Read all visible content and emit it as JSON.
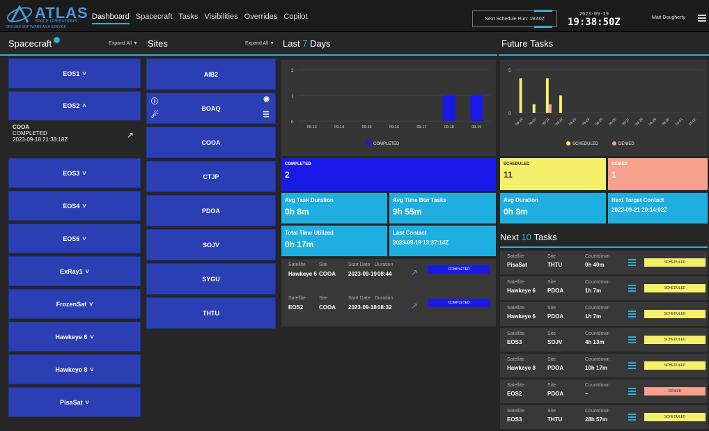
{
  "app": {
    "logo_title": "ATLAS",
    "logo_sub": "SPACE OPERATIONS",
    "logo_tag": "GROUND SOFTWARE AS A SERVICE",
    "nav": [
      "Dashboard",
      "Spacecraft",
      "Tasks",
      "Visibilities",
      "Overrides",
      "Copilot"
    ],
    "next_schedule": "Next Schedule Run: 19:40Z",
    "date": "2023-09-19",
    "time": "19:38:50Z",
    "user": "Matt Dougherty"
  },
  "spacecraft": {
    "title": "Spacecraft",
    "expand_label": "Expand All",
    "items": [
      "EOS1",
      "EOS2",
      "EOS3",
      "EOS4",
      "EOS6",
      "ExRay1",
      "FrozenSat",
      "Hawkeye 6",
      "Hawkeye 8",
      "PisaSat"
    ],
    "open_item": "EOS2",
    "detail": {
      "site": "COOA",
      "status": "COMPLETED",
      "time": "2023-09-18 21:38:18Z"
    }
  },
  "sites": {
    "title": "Sites",
    "expand_label": "Expand All",
    "items": [
      "AIB2",
      "BOAQ",
      "COOA",
      "CTJP",
      "PDOA",
      "SOJV",
      "SYGU",
      "THTU"
    ]
  },
  "last7": {
    "title_pre": "Last",
    "title_num": "7",
    "title_post": "Days",
    "chart_legend": "COMPLETED",
    "tiles": {
      "completed_label": "COMPLETED",
      "completed_value": "2",
      "avg_dur_label": "Avg Task Duration",
      "avg_dur_value": "0h 8m",
      "avg_btw_label": "Avg Time Btw Tasks",
      "avg_btw_value": "9h 55m",
      "total_label": "Total Time Utilized",
      "total_value": "0h 17m",
      "last_label": "Last Contact",
      "last_value": "2023-09-19 13:37:14Z"
    },
    "history": [
      {
        "sat": "Hawkeye 6",
        "site": "COOA",
        "start": "2023-09-19",
        "start_time": "08:44",
        "status": "COMPLETED"
      },
      {
        "sat": "EOS2",
        "site": "COOA",
        "start": "2023-09-18",
        "start_time": "08:32",
        "status": "COMPLETED"
      }
    ],
    "history_headers": {
      "satellite": "Satellite",
      "site": "Site",
      "start": "Start Date",
      "duration": "Duration"
    }
  },
  "future": {
    "title": "Future Tasks",
    "legend_scheduled": "SCHEDULED",
    "legend_denied": "DENIED",
    "tiles": {
      "scheduled_label": "SCHEDULED",
      "scheduled_value": "11",
      "denied_label": "DENIED",
      "denied_value": "1",
      "avg_label": "Avg Duration",
      "avg_value": "0h 8m",
      "next_label": "Next Target Contact",
      "next_value": "2023-09-21 20:14:02Z"
    },
    "next_title_pre": "Next",
    "next_title_num": "10",
    "next_title_post": "Tasks",
    "headers": {
      "satellite": "Satellite",
      "site": "Site",
      "countdown": "Countdown"
    },
    "tasks": [
      {
        "sat": "PisaSat",
        "site": "THTU",
        "countdown": "0h 40m",
        "status": "SCHEDULED"
      },
      {
        "sat": "Hawkeye 6",
        "site": "PDOA",
        "countdown": "1h 7m",
        "status": "SCHEDULED"
      },
      {
        "sat": "Hawkeye 6",
        "site": "PDOA",
        "countdown": "1h 7m",
        "status": "SCHEDULED"
      },
      {
        "sat": "EOS3",
        "site": "SOJV",
        "countdown": "4h 13m",
        "status": "SCHEDULED"
      },
      {
        "sat": "Hawkeye 8",
        "site": "PDOA",
        "countdown": "10h 17m",
        "status": "SCHEDULED"
      },
      {
        "sat": "EOS2",
        "site": "PDOA",
        "countdown": "–",
        "status": "DENIED"
      },
      {
        "sat": "EOS3",
        "site": "THTU",
        "countdown": "28h 57m",
        "status": "SCHEDULED"
      }
    ]
  },
  "colors": {
    "accent": "#2ab0e0",
    "card": "#2b3fb5",
    "completed": "#1a1ae8",
    "scheduled": "#f4f06a",
    "denied": "#f7a08e",
    "tile_blue": "#1faee0"
  },
  "chart_data": [
    {
      "type": "bar",
      "categories": [
        "09-13",
        "09-14",
        "09-15",
        "09-16",
        "09-17",
        "09-18",
        "09-19"
      ],
      "series": [
        {
          "name": "COMPLETED",
          "values": [
            0,
            0,
            0,
            0,
            0,
            1,
            1
          ]
        }
      ],
      "ylim": [
        0,
        2
      ],
      "yticks": [
        "0",
        "1",
        "2"
      ],
      "legend": "bottom"
    },
    {
      "type": "bar",
      "categories": [
        "09-19",
        "09-20",
        "09-21",
        "09-22",
        "09-23",
        "09-24",
        "09-25",
        "09-26",
        "09-27",
        "09-28",
        "09-29",
        "09-30",
        "10-01",
        "10-02"
      ],
      "series": [
        {
          "name": "SCHEDULED",
          "values": [
            4,
            1,
            4,
            2,
            0,
            0,
            0,
            0,
            0,
            0,
            0,
            0,
            0,
            0
          ]
        },
        {
          "name": "DENIED",
          "values": [
            0,
            0,
            1,
            0,
            0,
            0,
            0,
            0,
            0,
            0,
            0,
            0,
            0,
            0
          ]
        }
      ],
      "ylim": [
        0,
        5
      ],
      "yticks": [
        "0",
        "5"
      ],
      "legend": "bottom"
    }
  ]
}
